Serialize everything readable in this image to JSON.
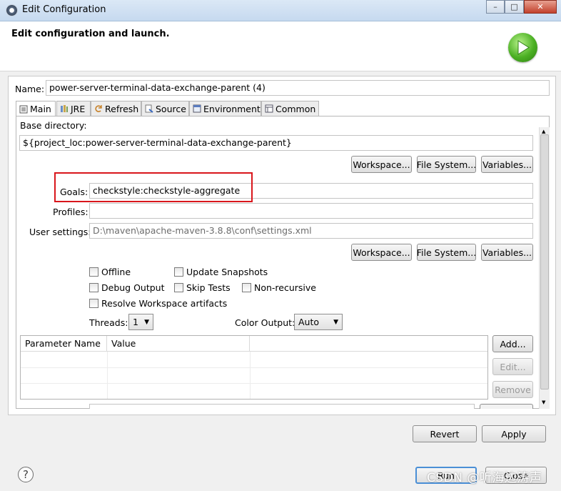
{
  "window": {
    "title": "Edit Configuration",
    "minimize": "–",
    "maximize": "□",
    "close": "✕"
  },
  "header": {
    "title": "Edit configuration and launch."
  },
  "name": {
    "label": "Name:",
    "value": "power-server-terminal-data-exchange-parent (4)"
  },
  "tabs": [
    {
      "label": "Main",
      "icon": "main-tab-icon"
    },
    {
      "label": "JRE",
      "icon": "jre-tab-icon"
    },
    {
      "label": "Refresh",
      "icon": "refresh-tab-icon"
    },
    {
      "label": "Source",
      "icon": "source-tab-icon"
    },
    {
      "label": "Environment",
      "icon": "environment-tab-icon"
    },
    {
      "label": "Common",
      "icon": "common-tab-icon"
    }
  ],
  "main": {
    "base_dir_label": "Base directory:",
    "base_dir_value": "${project_loc:power-server-terminal-data-exchange-parent}",
    "workspace": "Workspace...",
    "file_system": "File System...",
    "variables": "Variables...",
    "goals_label": "Goals:",
    "goals_value": "checkstyle:checkstyle-aggregate",
    "profiles_label": "Profiles:",
    "profiles_value": "",
    "user_settings_label": "User settings:",
    "user_settings_value": "D:\\maven\\apache-maven-3.8.8\\conf\\settings.xml",
    "offline": "Offline",
    "update_snapshots": "Update Snapshots",
    "debug_output": "Debug Output",
    "skip_tests": "Skip Tests",
    "non_recursive": "Non-recursive",
    "resolve_workspace": "Resolve Workspace artifacts",
    "threads_label": "Threads:",
    "threads_value": "1",
    "color_output_label": "Color Output:",
    "color_output_value": "Auto",
    "param_columns": [
      "Parameter Name",
      "Value"
    ],
    "add": "Add...",
    "edit": "Edit...",
    "remove": "Remove"
  },
  "footer": {
    "revert": "Revert",
    "apply": "Apply",
    "run": "Run",
    "close": "Close",
    "help": "?"
  },
  "watermark": "CSDN @听海边涛声",
  "colors": {
    "highlight": "#d9161c",
    "run_green": "#4bb023"
  }
}
